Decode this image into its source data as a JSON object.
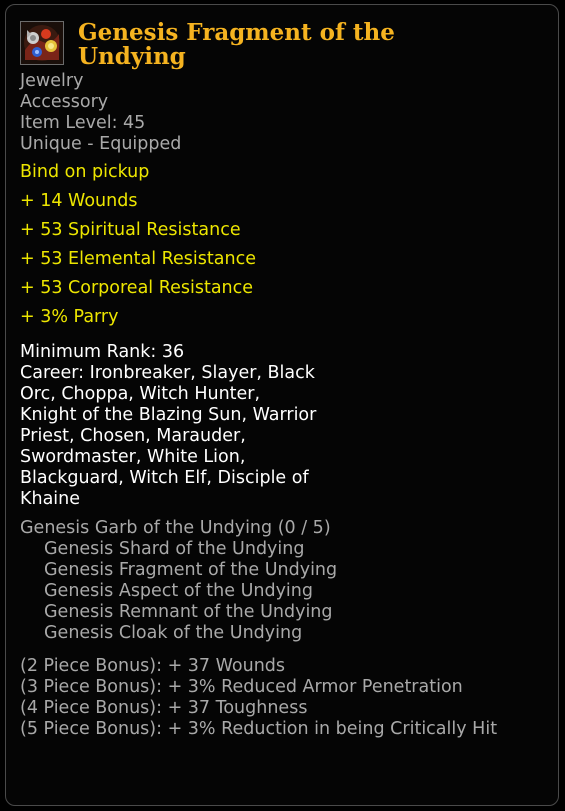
{
  "item": {
    "name": "Genesis Fragment of the Undying",
    "icon": "jewelry-item-icon",
    "type": "Jewelry",
    "slot": "Accessory",
    "item_level": "Item Level: 45",
    "unique": "Unique - Equipped",
    "bind": "Bind on pickup"
  },
  "stats": [
    "+ 14 Wounds",
    "+ 53 Spiritual Resistance",
    "+ 53 Elemental Resistance",
    "+ 53 Corporeal Resistance",
    "+ 3% Parry"
  ],
  "requirements": {
    "min_rank": "Minimum Rank: 36",
    "career": "Career: Ironbreaker, Slayer, Black Orc, Choppa, Witch Hunter, Knight of the Blazing Sun, Warrior Priest, Chosen, Marauder, Swordmaster, White Lion, Blackguard, Witch Elf, Disciple of Khaine"
  },
  "set": {
    "title": "Genesis Garb of the Undying (0 / 5)",
    "items": [
      "Genesis Shard of the Undying",
      "Genesis Fragment of the Undying",
      "Genesis Aspect of the Undying",
      "Genesis Remnant of the Undying",
      "Genesis Cloak of the Undying"
    ],
    "bonuses": [
      "(2 Piece Bonus): + 37 Wounds",
      "(3 Piece Bonus): + 3% Reduced Armor Penetration",
      "(4 Piece Bonus): + 37 Toughness",
      "(5 Piece Bonus): + 3% Reduction in being Critically Hit"
    ]
  },
  "colors": {
    "name": "#f5b320",
    "stat": "#ede600",
    "info": "#a9a9a9",
    "requirement": "#ffffff"
  }
}
